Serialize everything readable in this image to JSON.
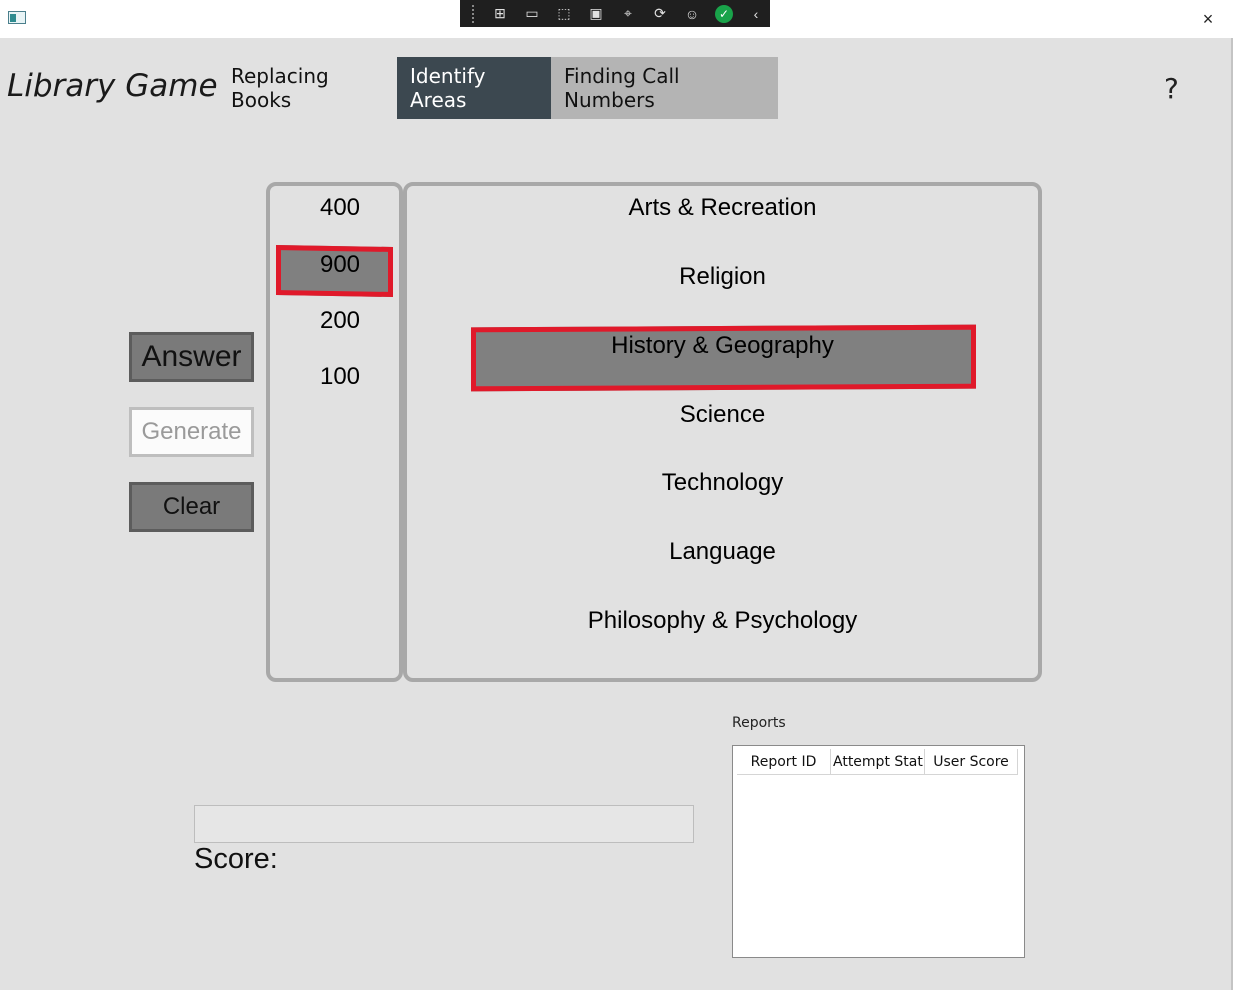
{
  "window": {
    "app_icon": "app-icon",
    "close_icon": "×",
    "devtools_icons": [
      "live-visual-tree-icon",
      "record-icon",
      "select-element-icon",
      "display-layout-adorners-icon",
      "track-focus-icon",
      "hot-reload-icon",
      "accessibility-icon",
      "check-icon",
      "collapse-icon"
    ]
  },
  "header": {
    "title": "Library Game",
    "tabs": [
      {
        "label": "Replacing Books"
      },
      {
        "label": "Identify Areas"
      },
      {
        "label": "Finding Call Numbers"
      }
    ],
    "help": "?"
  },
  "call_numbers": {
    "items": [
      "400",
      "900",
      "200",
      "100"
    ],
    "selected": "900"
  },
  "areas": {
    "items": [
      "Arts & Recreation",
      "Religion",
      "History & Geography",
      "Science",
      "Technology",
      "Language",
      "Philosophy & Psychology"
    ],
    "selected": "History & Geography"
  },
  "buttons": {
    "answer": "Answer",
    "generate": "Generate",
    "clear": "Clear"
  },
  "score": {
    "label": "Score:",
    "progress": 0
  },
  "reports": {
    "label": "Reports",
    "columns": [
      "Report ID",
      "Attempt Statu",
      "User Score"
    ],
    "rows": []
  },
  "colors": {
    "active_tab": "#3c4850",
    "inactive_tab": "#b4b4b4",
    "selection_fill": "#808080",
    "selection_outline": "#e0192a",
    "background": "#e1e1e1"
  }
}
